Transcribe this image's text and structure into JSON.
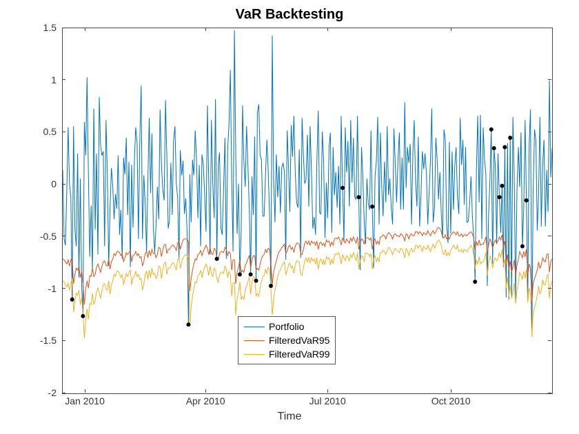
{
  "chart_data": {
    "type": "line",
    "title": "VaR Backtesting",
    "xlabel": "Time",
    "ylabel": "",
    "ylim": [
      -2,
      1.5
    ],
    "xlim_days": [
      0,
      365
    ],
    "x_ticks": [
      {
        "day": 17,
        "label": "Jan 2010"
      },
      {
        "day": 107,
        "label": "Apr 2010"
      },
      {
        "day": 198,
        "label": "Jul 2010"
      },
      {
        "day": 290,
        "label": "Oct 2010"
      }
    ],
    "y_ticks": [
      -2,
      -1.5,
      -1,
      -0.5,
      0,
      0.5,
      1,
      1.5
    ],
    "series": [
      {
        "name": "Portfolio",
        "color": "#0072BD",
        "values": [
          0.14,
          -0.52,
          -0.58,
          -0.06,
          0.55,
          0.01,
          -0.12,
          -1.1,
          0.56,
          -0.43,
          -0.59,
          0.3,
          -0.89,
          0.06,
          -0.97,
          -1.26,
          0.6,
          0.28,
          1.03,
          0.08,
          -0.69,
          -0.2,
          -0.83,
          0.73,
          -0.43,
          0.3,
          -0.67,
          0.84,
          0.38,
          0.28,
          0.32,
          -0.59,
          0.62,
          0.12,
          -0.78,
          -0.24,
          0.16,
          -0.01,
          -0.33,
          -0.09,
          -0.23,
          0.28,
          -0.48,
          -0.24,
          -0.71,
          0.26,
          0.1,
          0.45,
          -0.29,
          0.22,
          -0.79,
          0.19,
          -0.41,
          0.24,
          0.55,
          0.4,
          -0.52,
          0.41,
          0.95,
          -0.52,
          0.09,
          -0.17,
          -0.65,
          0.07,
          0.64,
          -0.08,
          0.49,
          -0.4,
          -0.65,
          -0.4,
          -0.02,
          -0.33,
          0.72,
          0.2,
          -0.04,
          -0.15,
          0.81,
          0.29,
          -0.42,
          -0.34,
          0.21,
          -0.29,
          0.42,
          0.56,
          0.01,
          -0.12,
          -0.72,
          0.33,
          0.09,
          0.23,
          -0.28,
          -0.13,
          -0.44,
          -1.34,
          0.1,
          -0.36,
          0.24,
          0.09,
          0.52,
          0.23,
          -0.32,
          0.19,
          -0.59,
          0.29,
          0.19,
          -0.09,
          -0.45,
          0.76,
          0.03,
          -0.67,
          0.62,
          0.01,
          -0.32,
          0.82,
          -0.71,
          0.19,
          0.31,
          -0.42,
          -0.48,
          -0.03,
          0.45,
          -0.71,
          0.33,
          0.58,
          1.1,
          0.02,
          -0.64,
          1.48,
          0.31,
          -0.47,
          0.01,
          -0.86,
          -0.45,
          0.76,
          0.23,
          -0.02,
          0.56,
          0.18,
          -0.24,
          -0.86,
          0.08,
          -0.29,
          0.46,
          -0.92,
          0.69,
          0.77,
          0.28,
          0.24,
          -0.3,
          -0.3,
          0.1,
          0.43,
          0.14,
          -0.31,
          -0.97,
          1.43,
          0.04,
          -0.36,
          0.29,
          -0.12,
          0.18,
          -0.27,
          0.16,
          0.21,
          0.12,
          -0.72,
          0.52,
          0.18,
          -0.26,
          0.57,
          0.27,
          0.66,
          0.12,
          -0.17,
          -0.22,
          0.34,
          -0.7,
          0.64,
          0.29,
          0.01,
          0.05,
          0.48,
          -0.21,
          0.56,
          0.12,
          -0.42,
          -0.31,
          -0.48,
          0.22,
          0.71,
          -0.27,
          -0.28,
          0.51,
          0.23,
          -0.51,
          0.02,
          -0.32,
          0.36,
          0.5,
          -0.46,
          0.36,
          -0.1,
          0.12,
          -0.22,
          0.18,
          -0.38,
          0.66,
          -0.03,
          -0.55,
          0.55,
          0.12,
          0.42,
          -0.21,
          0.62,
          0.02,
          0.45,
          -0.12,
          -0.14,
          0.66,
          -0.12,
          -0.82,
          0.36,
          0.08,
          -0.36,
          -0.57,
          0.06,
          -0.18,
          -0.24,
          0.52,
          -0.21,
          -0.8,
          0.08,
          0.22,
          0.65,
          -0.38,
          0.5,
          -0.03,
          -0.3,
          0.22,
          -0.17,
          0.56,
          -0.1,
          0.06,
          -0.22,
          -0.38,
          0.54,
          0.2,
          -0.17,
          0.24,
          0.5,
          -0.24,
          0.26,
          -0.24,
          0.79,
          -0.03,
          0.36,
          0.21,
          0.39,
          -0.38,
          0.3,
          0.62,
          0.03,
          -0.21,
          0.46,
          -0.4,
          -0.1,
          0.32,
          0.15,
          0.3,
          0.12,
          -0.38,
          -0.08,
          0.23,
          0.73,
          -0.36,
          -0.22,
          0.45,
          0.23,
          -0.14,
          0.12,
          -0.28,
          -0.51,
          0.53,
          0.43,
          -0.38,
          -0.56,
          0.41,
          -0.47,
          0.32,
          -0.24,
          0.18,
          0.36,
          -0.12,
          -0.28,
          0.64,
          0.19,
          0.43,
          -0.19,
          0.36,
          -0.36,
          -0.35,
          -0.17,
          0.08,
          -0.3,
          -0.5,
          -0.93,
          0.14,
          0.66,
          -0.17,
          0.67,
          -0.52,
          0.55,
          0.25,
          0.1,
          -0.97,
          -0.3,
          0.05,
          0.53,
          -0.76,
          0.35,
          0.18,
          -0.57,
          0.3,
          -0.12,
          -0.46,
          -0.01,
          -0.79,
          0.36,
          -1.08,
          0.4,
          -1.1,
          0.45,
          -1.08,
          0.65,
          0.06,
          -1.11,
          -0.06,
          0.36,
          -0.02,
          0.5,
          -0.59,
          -0.24,
          0.62,
          -0.15,
          -1.1,
          0.38,
          0.72,
          -1.44,
          -0.06,
          0.53,
          0.42,
          -0.44,
          -0.09,
          0.65,
          -0.4,
          0.19,
          0.43,
          -0.4,
          0.14,
          -0.26,
          1.0,
          0.07,
          0.35
        ]
      },
      {
        "name": "FilteredVaR95",
        "color": "#D95319",
        "values": [
          -0.71,
          -0.72,
          -0.74,
          -0.76,
          -0.72,
          -0.78,
          -0.72,
          -0.7,
          -0.95,
          -0.86,
          -0.8,
          -0.82,
          -0.78,
          -0.89,
          -0.83,
          -0.95,
          -1.15,
          -1.0,
          -0.92,
          -0.99,
          -0.87,
          -0.88,
          -0.8,
          -0.88,
          -0.86,
          -0.79,
          -0.76,
          -0.8,
          -0.84,
          -0.78,
          -0.74,
          -0.73,
          -0.77,
          -0.78,
          -0.71,
          -0.81,
          -0.74,
          -0.71,
          -0.66,
          -0.68,
          -0.64,
          -0.64,
          -0.65,
          -0.68,
          -0.66,
          -0.74,
          -0.7,
          -0.65,
          -0.67,
          -0.65,
          -0.63,
          -0.74,
          -0.68,
          -0.67,
          -0.64,
          -0.68,
          -0.66,
          -0.7,
          -0.69,
          -0.78,
          -0.73,
          -0.66,
          -0.64,
          -0.7,
          -0.63,
          -0.68,
          -0.62,
          -0.66,
          -0.65,
          -0.7,
          -0.67,
          -0.6,
          -0.61,
          -0.69,
          -0.63,
          -0.58,
          -0.57,
          -0.66,
          -0.62,
          -0.62,
          -0.6,
          -0.58,
          -0.58,
          -0.6,
          -0.63,
          -0.56,
          -0.54,
          -0.62,
          -0.57,
          -0.53,
          -0.52,
          -0.52,
          -0.52,
          -0.55,
          -1.02,
          -0.9,
          -0.82,
          -0.76,
          -0.71,
          -0.72,
          -0.67,
          -0.66,
          -0.63,
          -0.68,
          -0.64,
          -0.61,
          -0.58,
          -0.61,
          -0.67,
          -0.6,
          -0.66,
          -0.67,
          -0.61,
          -0.62,
          -0.7,
          -0.72,
          -0.66,
          -0.64,
          -0.64,
          -0.65,
          -0.6,
          -0.62,
          -0.68,
          -0.64,
          -0.66,
          -0.82,
          -0.72,
          -0.72,
          -0.95,
          -0.84,
          -0.79,
          -0.72,
          -0.84,
          -0.82,
          -0.84,
          -0.77,
          -0.75,
          -0.71,
          -0.68,
          -0.8,
          -0.72,
          -0.68,
          -0.68,
          -0.82,
          -0.8,
          -0.82,
          -0.76,
          -0.71,
          -0.68,
          -0.67,
          -0.62,
          -0.65,
          -0.61,
          -0.62,
          -0.76,
          -0.96,
          -0.84,
          -0.78,
          -0.73,
          -0.68,
          -0.64,
          -0.63,
          -0.6,
          -0.59,
          -0.57,
          -0.66,
          -0.64,
          -0.59,
          -0.58,
          -0.62,
          -0.6,
          -0.65,
          -0.59,
          -0.56,
          -0.56,
          -0.57,
          -0.66,
          -0.67,
          -0.62,
          -0.56,
          -0.54,
          -0.57,
          -0.54,
          -0.58,
          -0.54,
          -0.56,
          -0.55,
          -0.58,
          -0.54,
          -0.62,
          -0.56,
          -0.55,
          -0.58,
          -0.56,
          -0.59,
          -0.53,
          -0.55,
          -0.54,
          -0.59,
          -0.55,
          -0.58,
          -0.52,
          -0.51,
          -0.52,
          -0.5,
          -0.53,
          -0.58,
          -0.51,
          -0.54,
          -0.56,
          -0.52,
          -0.54,
          -0.56,
          -0.51,
          -0.54,
          -0.5,
          -0.53,
          -0.56,
          -0.5,
          -0.62,
          -0.56,
          -0.52,
          -0.53,
          -0.57,
          -0.5,
          -0.51,
          -0.51,
          -0.53,
          -0.51,
          -0.62,
          -0.54,
          -0.52,
          -0.57,
          -0.54,
          -0.57,
          -0.5,
          -0.5,
          -0.48,
          -0.49,
          -0.52,
          -0.48,
          -0.46,
          -0.47,
          -0.49,
          -0.52,
          -0.48,
          -0.47,
          -0.49,
          -0.49,
          -0.5,
          -0.47,
          -0.48,
          -0.5,
          -0.54,
          -0.47,
          -0.48,
          -0.52,
          -0.48,
          -0.47,
          -0.49,
          -0.49,
          -0.45,
          -0.45,
          -0.47,
          -0.45,
          -0.46,
          -0.49,
          -0.46,
          -0.47,
          -0.48,
          -0.44,
          -0.47,
          -0.49,
          -0.46,
          -0.44,
          -0.47,
          -0.45,
          -0.42,
          -0.41,
          -0.42,
          -0.45,
          -0.5,
          -0.51,
          -0.48,
          -0.52,
          -0.5,
          -0.52,
          -0.48,
          -0.47,
          -0.45,
          -0.46,
          -0.48,
          -0.45,
          -0.49,
          -0.49,
          -0.47,
          -0.5,
          -0.48,
          -0.48,
          -0.49,
          -0.47,
          -0.46,
          -0.45,
          -0.47,
          -0.51,
          -0.62,
          -0.55,
          -0.58,
          -0.53,
          -0.58,
          -0.57,
          -0.57,
          -0.54,
          -0.5,
          -0.66,
          -0.58,
          -0.52,
          -0.55,
          -0.61,
          -0.56,
          -0.53,
          -0.56,
          -0.54,
          -0.5,
          -0.53,
          -0.48,
          -0.6,
          -0.54,
          -0.76,
          -0.67,
          -0.82,
          -0.73,
          -0.84,
          -0.79,
          -0.72,
          -0.88,
          -0.77,
          -0.72,
          -0.64,
          -0.67,
          -0.7,
          -0.64,
          -0.69,
          -0.62,
          -0.86,
          -0.76,
          -0.8,
          -1.12,
          -0.95,
          -0.9,
          -0.86,
          -0.82,
          -0.74,
          -0.8,
          -0.77,
          -0.7,
          -0.73,
          -0.74,
          -0.67,
          -0.66,
          -0.84,
          -0.74,
          -0.71
        ]
      },
      {
        "name": "FilteredVaR99",
        "color": "#EDB120",
        "values": [
          -0.92,
          -0.93,
          -0.96,
          -0.98,
          -0.94,
          -1.01,
          -0.94,
          -0.9,
          -1.22,
          -1.11,
          -1.04,
          -1.06,
          -1.01,
          -1.15,
          -1.08,
          -1.24,
          -1.47,
          -1.3,
          -1.19,
          -1.29,
          -1.14,
          -1.15,
          -1.04,
          -1.15,
          -1.11,
          -1.03,
          -0.99,
          -1.04,
          -1.09,
          -1.01,
          -0.96,
          -0.95,
          -1.0,
          -1.01,
          -0.92,
          -1.05,
          -0.96,
          -0.92,
          -0.86,
          -0.88,
          -0.83,
          -0.83,
          -0.85,
          -0.89,
          -0.86,
          -0.96,
          -0.9,
          -0.85,
          -0.88,
          -0.84,
          -0.82,
          -0.96,
          -0.89,
          -0.88,
          -0.83,
          -0.88,
          -0.86,
          -0.91,
          -0.9,
          -1.01,
          -0.95,
          -0.86,
          -0.83,
          -0.91,
          -0.82,
          -0.89,
          -0.8,
          -0.86,
          -0.85,
          -0.9,
          -0.87,
          -0.78,
          -0.79,
          -0.9,
          -0.82,
          -0.76,
          -0.74,
          -0.86,
          -0.8,
          -0.8,
          -0.78,
          -0.75,
          -0.75,
          -0.78,
          -0.82,
          -0.72,
          -0.7,
          -0.8,
          -0.74,
          -0.7,
          -0.68,
          -0.67,
          -0.68,
          -0.71,
          -1.34,
          -1.17,
          -1.07,
          -1.0,
          -0.93,
          -0.94,
          -0.87,
          -0.86,
          -0.82,
          -0.89,
          -0.83,
          -0.79,
          -0.76,
          -0.8,
          -0.87,
          -0.78,
          -0.86,
          -0.88,
          -0.8,
          -0.82,
          -0.9,
          -0.94,
          -0.86,
          -0.84,
          -0.84,
          -0.85,
          -0.78,
          -0.81,
          -0.89,
          -0.83,
          -0.86,
          -1.07,
          -0.94,
          -0.94,
          -1.25,
          -1.1,
          -1.03,
          -0.93,
          -1.1,
          -1.07,
          -1.1,
          -1.01,
          -0.97,
          -0.93,
          -0.88,
          -1.05,
          -0.93,
          -0.88,
          -0.89,
          -1.07,
          -1.04,
          -1.07,
          -0.99,
          -0.93,
          -0.88,
          -0.87,
          -0.81,
          -0.85,
          -0.79,
          -0.81,
          -1.0,
          -1.25,
          -1.1,
          -1.01,
          -0.95,
          -0.88,
          -0.83,
          -0.82,
          -0.78,
          -0.76,
          -0.74,
          -0.86,
          -0.83,
          -0.77,
          -0.75,
          -0.8,
          -0.78,
          -0.85,
          -0.77,
          -0.73,
          -0.73,
          -0.74,
          -0.86,
          -0.87,
          -0.8,
          -0.73,
          -0.7,
          -0.74,
          -0.7,
          -0.75,
          -0.7,
          -0.73,
          -0.71,
          -0.76,
          -0.7,
          -0.81,
          -0.73,
          -0.71,
          -0.76,
          -0.72,
          -0.77,
          -0.69,
          -0.71,
          -0.7,
          -0.77,
          -0.71,
          -0.76,
          -0.68,
          -0.66,
          -0.67,
          -0.65,
          -0.69,
          -0.76,
          -0.67,
          -0.7,
          -0.73,
          -0.68,
          -0.7,
          -0.73,
          -0.67,
          -0.7,
          -0.65,
          -0.69,
          -0.73,
          -0.65,
          -0.81,
          -0.73,
          -0.68,
          -0.69,
          -0.74,
          -0.65,
          -0.66,
          -0.66,
          -0.69,
          -0.66,
          -0.81,
          -0.71,
          -0.68,
          -0.74,
          -0.7,
          -0.74,
          -0.65,
          -0.65,
          -0.63,
          -0.64,
          -0.67,
          -0.63,
          -0.6,
          -0.61,
          -0.64,
          -0.67,
          -0.63,
          -0.61,
          -0.63,
          -0.64,
          -0.65,
          -0.61,
          -0.62,
          -0.65,
          -0.7,
          -0.61,
          -0.63,
          -0.68,
          -0.63,
          -0.61,
          -0.64,
          -0.64,
          -0.58,
          -0.58,
          -0.61,
          -0.58,
          -0.6,
          -0.64,
          -0.59,
          -0.61,
          -0.62,
          -0.58,
          -0.61,
          -0.64,
          -0.6,
          -0.57,
          -0.61,
          -0.58,
          -0.55,
          -0.53,
          -0.55,
          -0.58,
          -0.65,
          -0.67,
          -0.62,
          -0.68,
          -0.65,
          -0.68,
          -0.63,
          -0.61,
          -0.58,
          -0.6,
          -0.62,
          -0.58,
          -0.64,
          -0.64,
          -0.62,
          -0.65,
          -0.62,
          -0.63,
          -0.64,
          -0.62,
          -0.6,
          -0.58,
          -0.61,
          -0.67,
          -0.81,
          -0.72,
          -0.76,
          -0.69,
          -0.76,
          -0.74,
          -0.74,
          -0.71,
          -0.65,
          -0.87,
          -0.76,
          -0.68,
          -0.72,
          -0.8,
          -0.73,
          -0.7,
          -0.73,
          -0.71,
          -0.65,
          -0.7,
          -0.62,
          -0.78,
          -0.71,
          -0.99,
          -0.88,
          -1.07,
          -0.96,
          -1.09,
          -1.03,
          -0.94,
          -1.14,
          -1.01,
          -0.94,
          -0.84,
          -0.87,
          -0.91,
          -0.83,
          -0.9,
          -0.81,
          -1.13,
          -0.99,
          -1.04,
          -1.46,
          -1.24,
          -1.17,
          -1.13,
          -1.06,
          -0.97,
          -1.05,
          -1.01,
          -0.91,
          -0.96,
          -0.96,
          -0.88,
          -0.86,
          -1.09,
          -0.96,
          -0.92
        ]
      }
    ],
    "violations_days": [
      7,
      15,
      93,
      114,
      131,
      139,
      143,
      154,
      207,
      219,
      229,
      305,
      317,
      319,
      323,
      325,
      327,
      331,
      340,
      343
    ],
    "legend_position": "bottom-center"
  }
}
